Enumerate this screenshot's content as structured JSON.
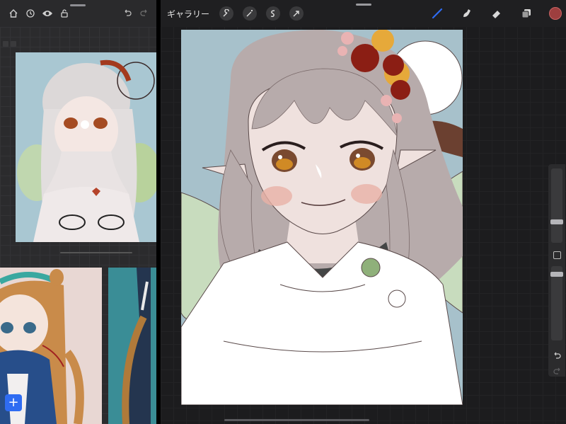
{
  "left_app": {
    "toolbar_icons": [
      "home-icon",
      "clock-icon",
      "eye-icon",
      "lock-icon",
      "undo-icon",
      "redo-icon"
    ],
    "add_label": "+"
  },
  "main_app": {
    "gallery_label": "ギャラリー",
    "action_icons": [
      "wrench-icon",
      "magic-wand-icon",
      "selection-icon",
      "transform-arrow-icon"
    ],
    "tool_icons": [
      "brush-icon",
      "smudge-icon",
      "eraser-icon",
      "layers-icon"
    ],
    "current_color": "#9e3f3f",
    "accent": "#2f6cf2"
  }
}
